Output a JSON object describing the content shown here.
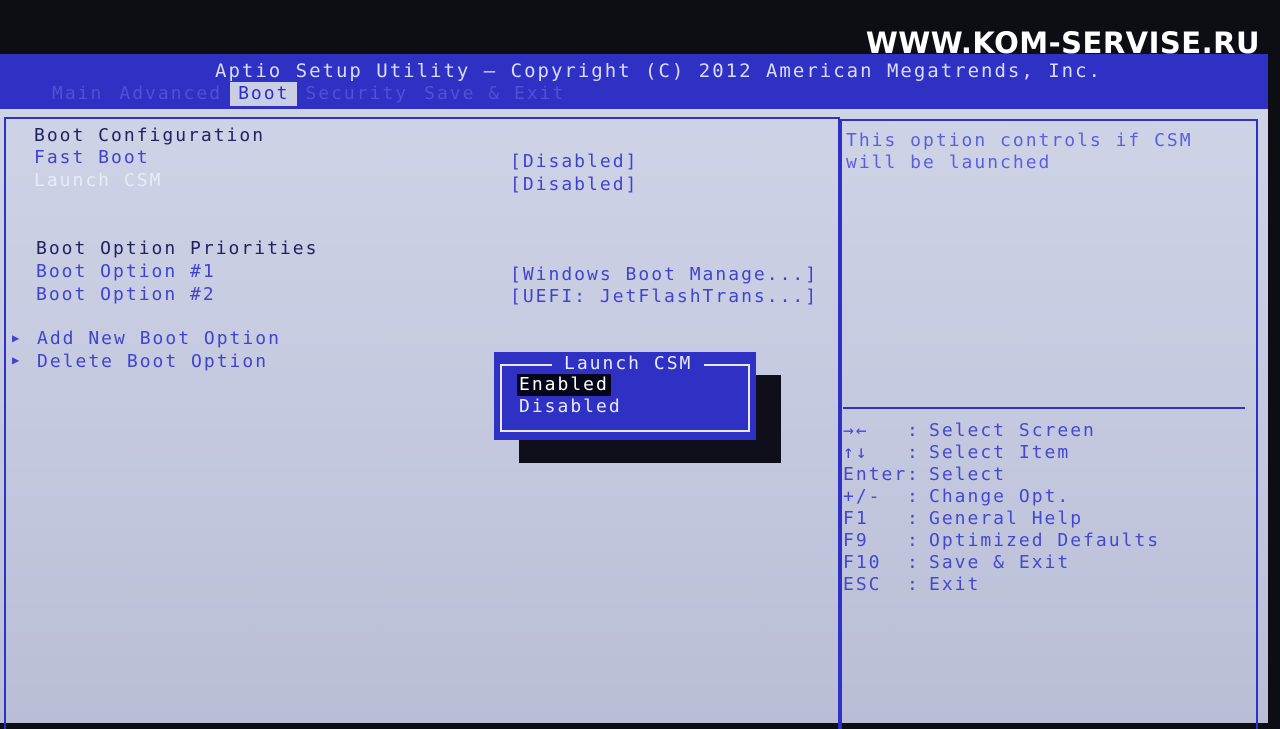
{
  "watermark": "WWW.KOM-SERVISE.RU",
  "header": {
    "title": "Aptio Setup Utility – Copyright (C) 2012 American Megatrends, Inc.",
    "tabs": [
      "Main",
      "Advanced",
      "Boot",
      "Security",
      "Save & Exit"
    ],
    "active_tab": "Boot"
  },
  "boot": {
    "config_heading": "Boot Configuration",
    "fast_boot_label": "Fast Boot",
    "fast_boot_value": "[Disabled]",
    "launch_csm_label": "Launch CSM",
    "launch_csm_value": "[Disabled]",
    "priorities_heading": "Boot Option Priorities",
    "option1_label": "Boot Option #1",
    "option1_value": "[Windows Boot Manage...]",
    "option2_label": "Boot Option #2",
    "option2_value": "[UEFI: JetFlashTrans...]",
    "add_new_label": "Add New Boot Option",
    "delete_label": "Delete Boot Option"
  },
  "popup": {
    "title": "Launch CSM",
    "options": [
      "Enabled",
      "Disabled"
    ],
    "selected": "Enabled"
  },
  "help": {
    "line1": "This option controls if CSM",
    "line2": "will be launched"
  },
  "keys": [
    {
      "key": "→←",
      "desc": "Select Screen"
    },
    {
      "key": "↑↓",
      "desc": "Select Item"
    },
    {
      "key": "Enter",
      "desc": "Select"
    },
    {
      "key": "+/-",
      "desc": "Change Opt."
    },
    {
      "key": "F1",
      "desc": "General Help"
    },
    {
      "key": "F9",
      "desc": "Optimized Defaults"
    },
    {
      "key": "F10",
      "desc": "Save & Exit"
    },
    {
      "key": "ESC",
      "desc": "Exit"
    }
  ],
  "colors": {
    "header_blue": "#2f30c4",
    "panel_bg": "#c9cee4",
    "text_blue": "#3f44d0",
    "selection_bg": "#06061a"
  }
}
